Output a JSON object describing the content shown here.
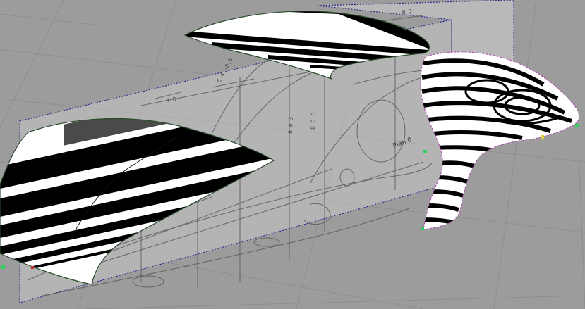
{
  "viewport": {
    "background_color": "#9c9c9c",
    "grid_color": "#8e8e8e",
    "construction_line_color": "#1a1a8c",
    "zebra_dark": "#000000",
    "zebra_light": "#ffffff"
  },
  "blueprint": {
    "dimension_labels": [
      "6 4 -0.5",
      "4 8",
      "6 0 3",
      "8 0 6",
      "6 2"
    ],
    "plane_label": "Plan 0"
  },
  "surfaces": {
    "roof": "zebra-analysis",
    "hood": "zebra-analysis",
    "rear_fender": "zebra-analysis"
  }
}
